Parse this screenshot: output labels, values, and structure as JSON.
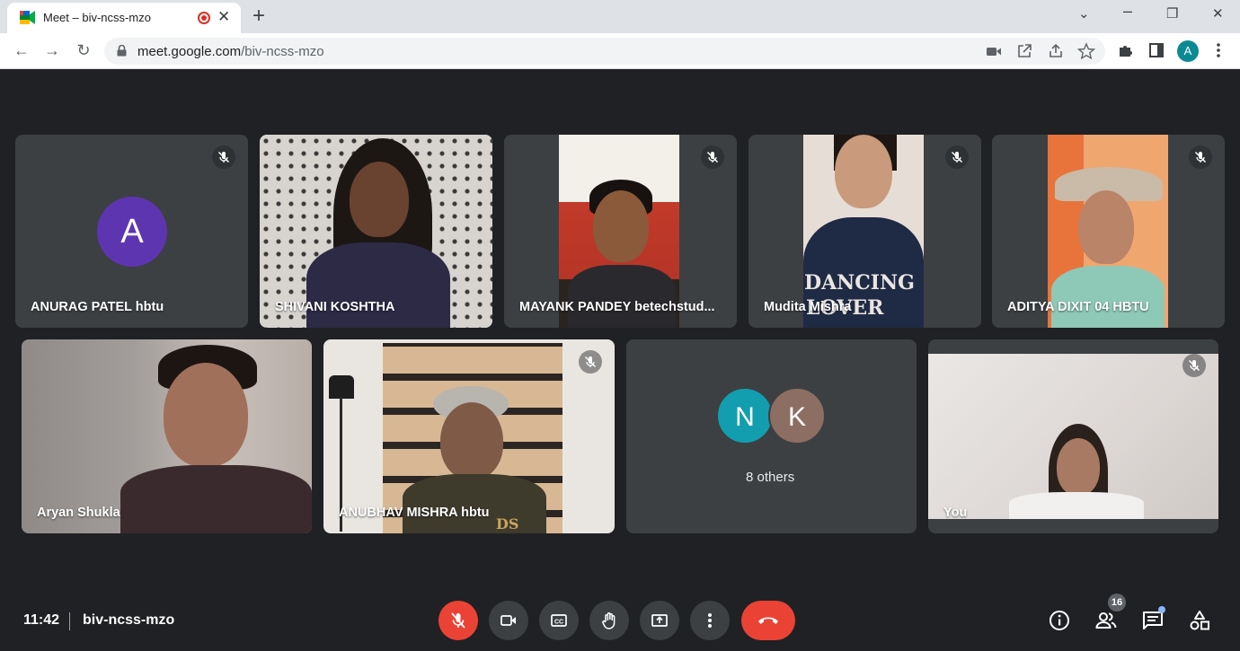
{
  "browser": {
    "tab_title": "Meet – biv-ncss-mzo",
    "tab_close": "✕",
    "new_tab": "+",
    "url_host": "meet.google.com",
    "url_path": "/biv-ncss-mzo",
    "profile_initial": "A",
    "window_controls": {
      "minimize": "⌄",
      "restore": "❐",
      "close": "✕"
    }
  },
  "participants": [
    {
      "name": "ANURAG PATEL hbtu",
      "avatar_initial": "A",
      "avatar_color": "#5e35b1",
      "muted": true
    },
    {
      "name": "SHIVANI KOSHTHA",
      "muted": false
    },
    {
      "name": "MAYANK PANDEY betechstud...",
      "muted": true
    },
    {
      "name": "Mudita Mishra",
      "shirt_text_1": "DANCING",
      "shirt_text_2": "LOVER",
      "muted": true
    },
    {
      "name": "ADITYA DIXIT 04 HBTU",
      "muted": true
    },
    {
      "name": "Aryan Shukla",
      "muted": false
    },
    {
      "name": "ANUBHAV MISHRA hbtu",
      "shirt_text": "DS",
      "muted": true
    },
    {
      "name": "8 others",
      "avatars": [
        {
          "initial": "N",
          "color": "#129eaf"
        },
        {
          "initial": "K",
          "color": "#8d6e63"
        }
      ]
    },
    {
      "name": "You",
      "muted": true
    }
  ],
  "meeting": {
    "time": "11:42",
    "code": "biv-ncss-mzo",
    "participant_count": "16"
  },
  "colors": {
    "stage_bg": "#202124",
    "tile_bg": "#3c4043",
    "danger": "#ea4335",
    "accent": "#8ab4f8"
  }
}
